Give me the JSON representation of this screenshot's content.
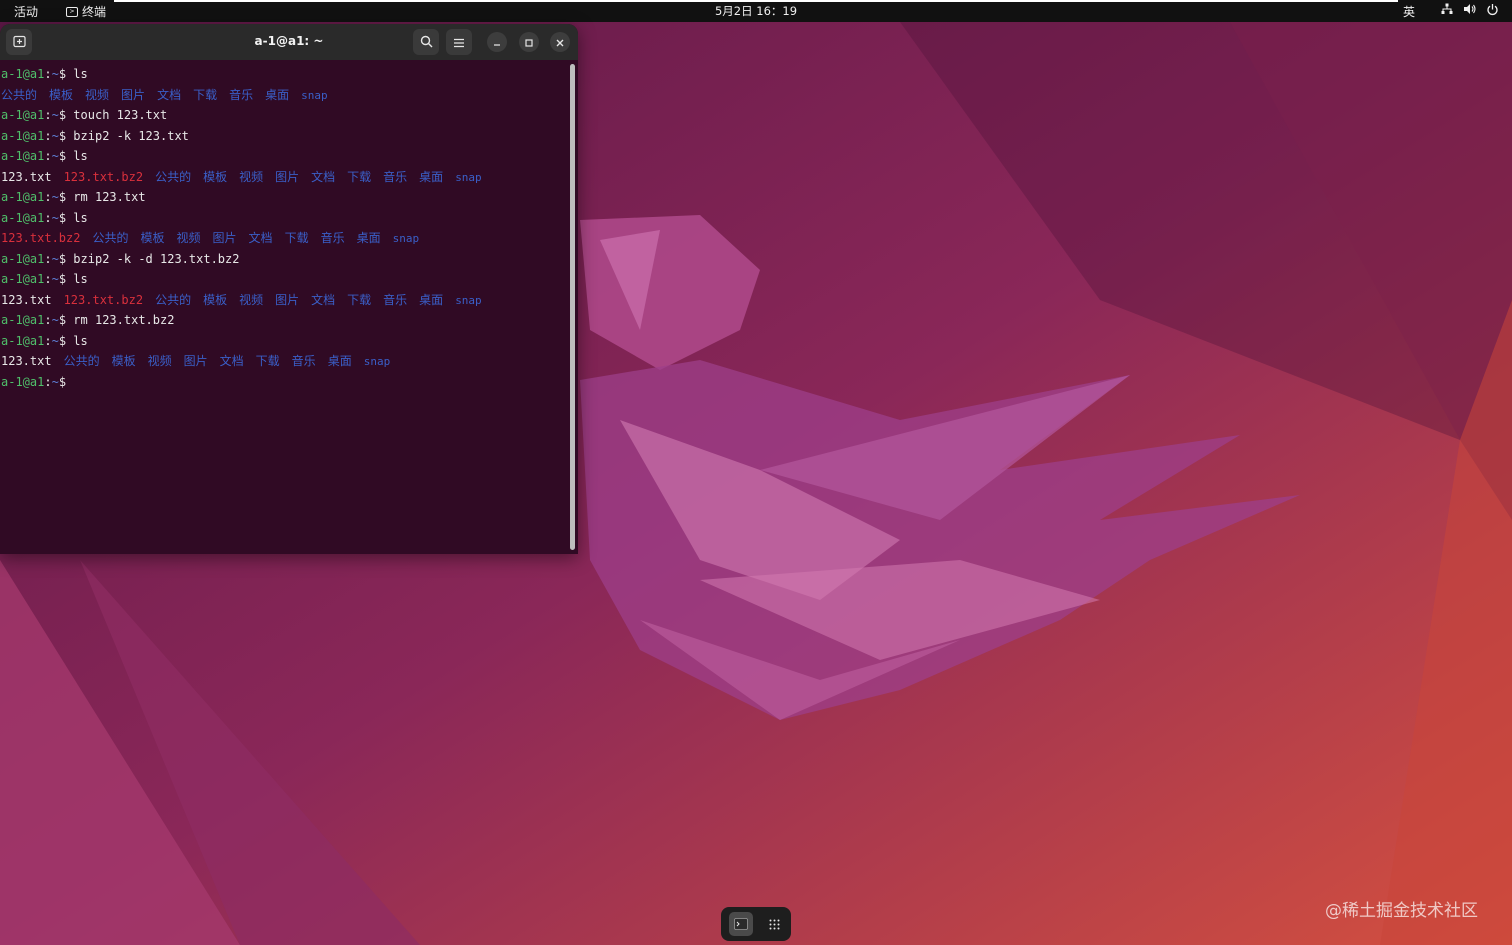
{
  "topbar": {
    "activities": "活动",
    "app_name": "终端",
    "clock": "5月2日  16：19",
    "input_method": "英",
    "network_icon": "network-icon",
    "volume_icon": "volume-icon",
    "power_icon": "power-icon"
  },
  "terminal": {
    "title": "a-1@a1: ~",
    "prompt": {
      "user": "a-1@a1",
      "sep": ":",
      "dir": "~",
      "sym": "$"
    },
    "lines": [
      {
        "type": "cmd",
        "cmd": "ls"
      },
      {
        "type": "ls",
        "items": [
          {
            "text": "公共的",
            "kind": "dir"
          },
          {
            "text": "模板",
            "kind": "dir"
          },
          {
            "text": "视频",
            "kind": "dir"
          },
          {
            "text": "图片",
            "kind": "dir"
          },
          {
            "text": "文档",
            "kind": "dir"
          },
          {
            "text": "下载",
            "kind": "dir"
          },
          {
            "text": "音乐",
            "kind": "dir"
          },
          {
            "text": "桌面",
            "kind": "dir"
          },
          {
            "text": "snap",
            "kind": "snap"
          }
        ]
      },
      {
        "type": "cmd",
        "cmd": "touch 123.txt"
      },
      {
        "type": "cmd",
        "cmd": "bzip2 -k 123.txt"
      },
      {
        "type": "cmd",
        "cmd": "ls"
      },
      {
        "type": "ls",
        "items": [
          {
            "text": "123.txt",
            "kind": "file"
          },
          {
            "text": "123.txt.bz2",
            "kind": "red"
          },
          {
            "text": "公共的",
            "kind": "dir"
          },
          {
            "text": "模板",
            "kind": "dir"
          },
          {
            "text": "视频",
            "kind": "dir"
          },
          {
            "text": "图片",
            "kind": "dir"
          },
          {
            "text": "文档",
            "kind": "dir"
          },
          {
            "text": "下载",
            "kind": "dir"
          },
          {
            "text": "音乐",
            "kind": "dir"
          },
          {
            "text": "桌面",
            "kind": "dir"
          },
          {
            "text": "snap",
            "kind": "snap"
          }
        ]
      },
      {
        "type": "cmd",
        "cmd": "rm 123.txt"
      },
      {
        "type": "cmd",
        "cmd": "ls"
      },
      {
        "type": "ls",
        "items": [
          {
            "text": "123.txt.bz2",
            "kind": "red"
          },
          {
            "text": "公共的",
            "kind": "dir"
          },
          {
            "text": "模板",
            "kind": "dir"
          },
          {
            "text": "视频",
            "kind": "dir"
          },
          {
            "text": "图片",
            "kind": "dir"
          },
          {
            "text": "文档",
            "kind": "dir"
          },
          {
            "text": "下载",
            "kind": "dir"
          },
          {
            "text": "音乐",
            "kind": "dir"
          },
          {
            "text": "桌面",
            "kind": "dir"
          },
          {
            "text": "snap",
            "kind": "snap"
          }
        ]
      },
      {
        "type": "cmd",
        "cmd": "bzip2 -k -d 123.txt.bz2"
      },
      {
        "type": "cmd",
        "cmd": "ls"
      },
      {
        "type": "ls",
        "items": [
          {
            "text": "123.txt",
            "kind": "file"
          },
          {
            "text": "123.txt.bz2",
            "kind": "red"
          },
          {
            "text": "公共的",
            "kind": "dir"
          },
          {
            "text": "模板",
            "kind": "dir"
          },
          {
            "text": "视频",
            "kind": "dir"
          },
          {
            "text": "图片",
            "kind": "dir"
          },
          {
            "text": "文档",
            "kind": "dir"
          },
          {
            "text": "下载",
            "kind": "dir"
          },
          {
            "text": "音乐",
            "kind": "dir"
          },
          {
            "text": "桌面",
            "kind": "dir"
          },
          {
            "text": "snap",
            "kind": "snap"
          }
        ]
      },
      {
        "type": "cmd",
        "cmd": "rm 123.txt.bz2"
      },
      {
        "type": "cmd",
        "cmd": "ls"
      },
      {
        "type": "ls",
        "items": [
          {
            "text": "123.txt",
            "kind": "file"
          },
          {
            "text": "公共的",
            "kind": "dir"
          },
          {
            "text": "模板",
            "kind": "dir"
          },
          {
            "text": "视频",
            "kind": "dir"
          },
          {
            "text": "图片",
            "kind": "dir"
          },
          {
            "text": "文档",
            "kind": "dir"
          },
          {
            "text": "下载",
            "kind": "dir"
          },
          {
            "text": "音乐",
            "kind": "dir"
          },
          {
            "text": "桌面",
            "kind": "dir"
          },
          {
            "text": "snap",
            "kind": "snap"
          }
        ]
      },
      {
        "type": "cmd",
        "cmd": ""
      }
    ]
  },
  "dock": {
    "terminal_icon": "terminal-icon",
    "apps_icon": "show-apps-icon"
  },
  "watermark": "@稀土掘金技术社区",
  "colors": {
    "terminal_bg": "#300a24",
    "prompt_user": "#4fbf6a",
    "directory": "#3a5fc8",
    "archive": "#d9303c"
  }
}
